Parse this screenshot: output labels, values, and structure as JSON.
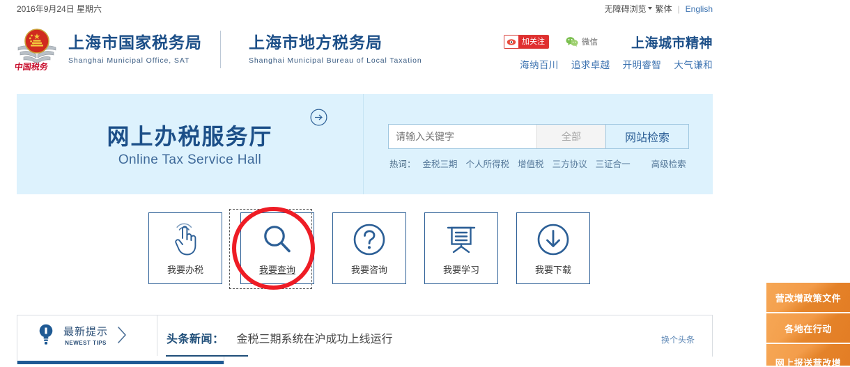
{
  "topbar": {
    "date": "2016年9月24日 星期六",
    "accessibility": "无障碍浏览",
    "traditional": "繁体",
    "separator": "|",
    "english": "English"
  },
  "masthead": {
    "emblem_alt": "china-taxation-emblem",
    "org1_cn": "上海市国家税务局",
    "org1_en": "Shanghai Municipal Office, SAT",
    "org2_cn": "上海市地方税务局",
    "org2_en": "Shanghai Municipal Bureau of Local Taxation",
    "weibo_label": "加关注",
    "wechat_label": "微信",
    "spirit_title": "上海城市精神",
    "spirit_words": [
      "海纳百川",
      "追求卓越",
      "开明睿智",
      "大气谦和"
    ]
  },
  "hero": {
    "title_cn": "网上办税服务厅",
    "title_en": "Online Tax Service Hall",
    "arrow_icon": "arrow-right-circle-icon"
  },
  "search": {
    "placeholder": "请输入关键字",
    "value": "",
    "scope_selected": "全部",
    "button_label": "网站检索",
    "hotwords_label": "热词：",
    "hotwords": [
      "金税三期",
      "个人所得税",
      "增值税",
      "三方协议",
      "三证合一"
    ],
    "advanced_label": "高级检索"
  },
  "cards": [
    {
      "label": "我要办税",
      "icon": "hand-tap-icon",
      "focused": false
    },
    {
      "label": "我要查询",
      "icon": "magnifier-icon",
      "focused": true
    },
    {
      "label": "我要咨询",
      "icon": "question-circle-icon",
      "focused": false
    },
    {
      "label": "我要学习",
      "icon": "presentation-board-icon",
      "focused": false
    },
    {
      "label": "我要下载",
      "icon": "download-circle-icon",
      "focused": false
    }
  ],
  "news": {
    "tips_cn": "最新提示",
    "tips_en": "NEWEST TIPS",
    "tips_icon": "lightbulb-icon",
    "chevron_icon": "chevron-right-icon",
    "headline_label": "头条新闻：",
    "headline_text": "金税三期系统在沪成功上线运行",
    "change_label": "换个头条"
  },
  "floaters": [
    {
      "label": "营改增政策文件"
    },
    {
      "label": "各地在行动"
    },
    {
      "label": "网上报送营改增"
    }
  ],
  "colors": {
    "brand_blue": "#1c4f88",
    "hero_bg": "#ddf2fd",
    "accent_orange": "#f18d2e",
    "annotation_red": "#ee1c25",
    "link_blue": "#3b72b0"
  }
}
